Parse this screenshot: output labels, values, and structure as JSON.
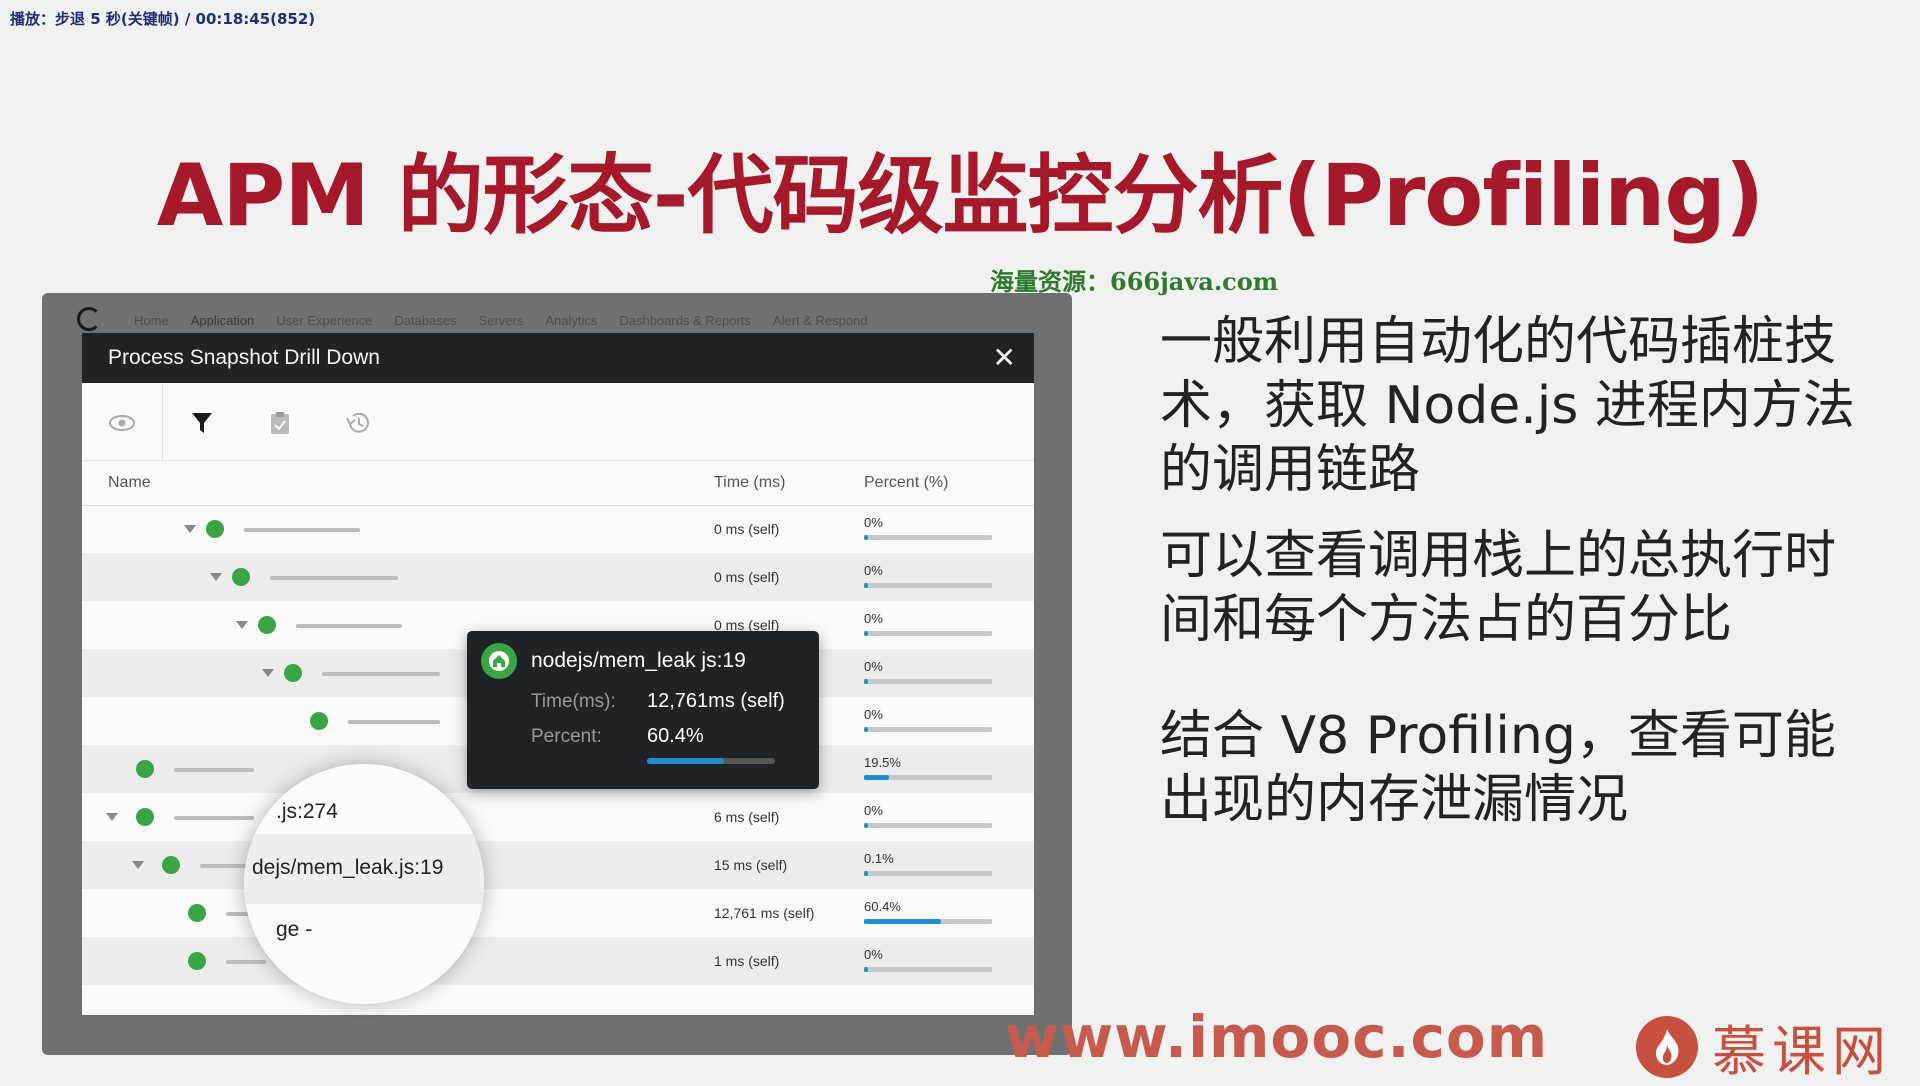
{
  "overlay": {
    "status": "播放：步退 5 秒(关键帧) / 00:18:45(852)"
  },
  "slide": {
    "title": "APM 的形态-代码级监控分析(Profiling)",
    "resource_note": "海量资源：666java.com",
    "bullets": [
      "一般利用自动化的代码插桩技术，获取 Node.js 进程内方法的调用链路",
      "可以查看调用栈上的总执行时间和每个方法占的百分比",
      "结合 V8 Profiling，查看可能出现的内存泄漏情况"
    ],
    "watermark": "www.imooc.com",
    "brand": "慕课网"
  },
  "app": {
    "nav_tabs": [
      "Home",
      "Application",
      "User Experience",
      "Databases",
      "Servers",
      "Analytics",
      "Dashboards & Reports",
      "Alert & Respond"
    ],
    "active_tab": "Application",
    "modal": {
      "title": "Process Snapshot Drill Down",
      "close": "✕",
      "toolbar_icons": [
        "eye-icon",
        "filter-icon",
        "clipboard-icon",
        "history-icon"
      ],
      "columns": {
        "name": "Name",
        "time": "Time (ms)",
        "percent": "Percent (%)"
      },
      "rows": [
        {
          "time": "0 ms (self)",
          "percent": "0%",
          "fraction": 0.0
        },
        {
          "time": "0 ms (self)",
          "percent": "0%",
          "fraction": 0.0
        },
        {
          "time": "0 ms (self)",
          "percent": "0%",
          "fraction": 0.0
        },
        {
          "time": "",
          "percent": "0%",
          "fraction": 0.0
        },
        {
          "time": "",
          "percent": "0%",
          "fraction": 0.0
        },
        {
          "time": "",
          "percent": "19.5%",
          "fraction": 0.195
        },
        {
          "time": "6 ms (self)",
          "percent": "0%",
          "fraction": 0.0
        },
        {
          "time": "15 ms (self)",
          "percent": "0.1%",
          "fraction": 0.001
        },
        {
          "time": "12,761 ms (self)",
          "percent": "60.4%",
          "fraction": 0.604
        },
        {
          "time": "1 ms (self)",
          "percent": "0%",
          "fraction": 0.0
        }
      ]
    },
    "tooltip": {
      "name": "nodejs/mem_leak js:19",
      "time_label": "Time(ms):",
      "time_value": "12,761ms (self)",
      "percent_label": "Percent:",
      "percent_value": "60.4%",
      "fraction": 0.604
    },
    "magnifier": {
      "lines": [
        ".js:274",
        "dejs/mem_leak.js:19",
        "ge -"
      ]
    }
  },
  "colors": {
    "title": "#a5192a",
    "node": "#3ba545",
    "bar": "#1f8fce",
    "brand": "#c8503f"
  }
}
